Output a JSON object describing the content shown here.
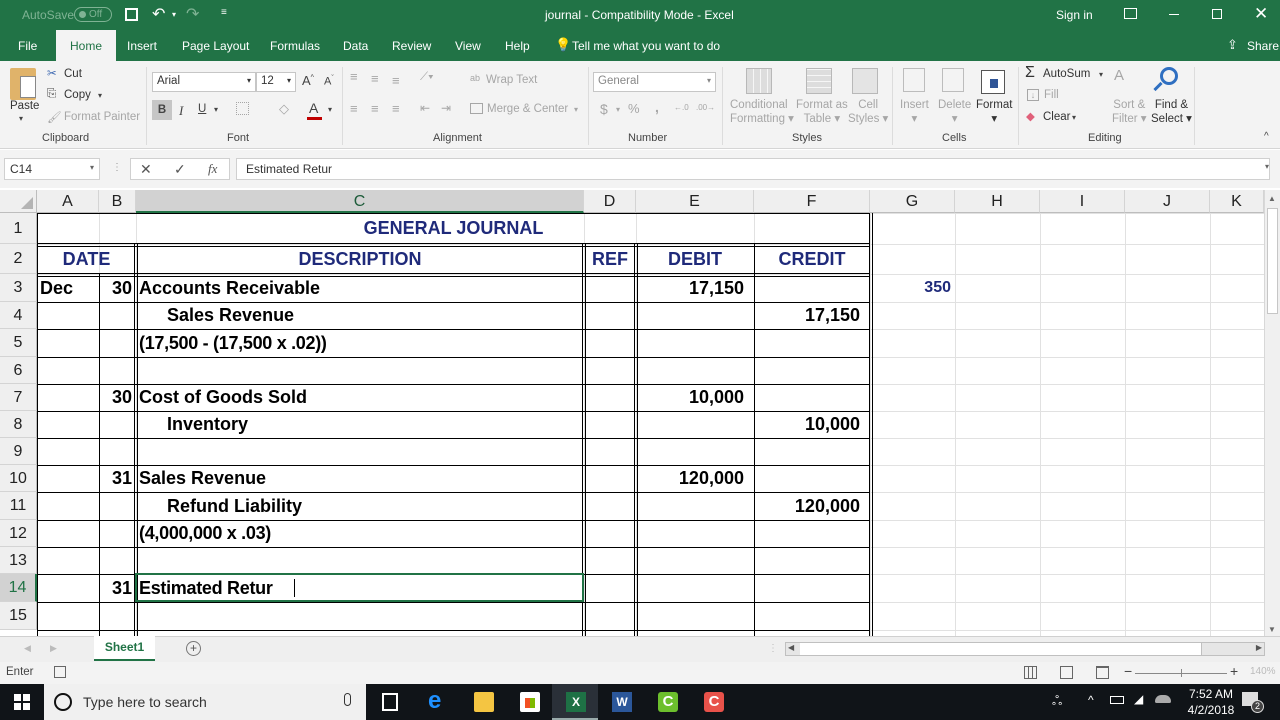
{
  "titlebar": {
    "autosave_label": "AutoSave",
    "autosave_state": "Off",
    "title": "journal  -  Compatibility Mode  -  Excel",
    "sign_in": "Sign in"
  },
  "tabs": [
    "File",
    "Home",
    "Insert",
    "Page Layout",
    "Formulas",
    "Data",
    "Review",
    "View",
    "Help"
  ],
  "tell_me": "Tell me what you want to do",
  "share": "Share",
  "ribbon": {
    "clipboard": {
      "label": "Clipboard",
      "paste": "Paste",
      "cut": "Cut",
      "copy": "Copy",
      "format_painter": "Format Painter"
    },
    "font": {
      "label": "Font",
      "font_name": "Arial",
      "font_size": "12",
      "bold": "B",
      "italic": "I",
      "underline": "U"
    },
    "alignment": {
      "label": "Alignment",
      "wrap_text": "Wrap Text",
      "merge_center": "Merge & Center"
    },
    "number": {
      "label": "Number",
      "format": "General",
      "currency": "$",
      "percent": "%",
      "comma": ","
    },
    "styles": {
      "label": "Styles",
      "conditional_1": "Conditional",
      "conditional_2": "Formatting",
      "format_table_1": "Format as",
      "format_table_2": "Table",
      "cell_styles_1": "Cell",
      "cell_styles_2": "Styles"
    },
    "cells": {
      "label": "Cells",
      "insert": "Insert",
      "delete": "Delete",
      "format": "Format"
    },
    "editing": {
      "label": "Editing",
      "autosum": "AutoSum",
      "fill": "Fill",
      "clear": "Clear",
      "sort_1": "Sort &",
      "sort_2": "Filter",
      "find_1": "Find &",
      "find_2": "Select"
    }
  },
  "formula_bar": {
    "name_box": "C14",
    "fx": "fx",
    "value": "Estimated Retur"
  },
  "columns": [
    "A",
    "B",
    "C",
    "D",
    "E",
    "F",
    "G",
    "H",
    "I",
    "J",
    "K"
  ],
  "rows": [
    "1",
    "2",
    "3",
    "4",
    "5",
    "6",
    "7",
    "8",
    "9",
    "10",
    "11",
    "12",
    "13",
    "14",
    "15"
  ],
  "sheet": {
    "title": "GENERAL JOURNAL",
    "headers": {
      "date": "DATE",
      "description": "DESCRIPTION",
      "ref": "REF",
      "debit": "DEBIT",
      "credit": "CREDIT"
    },
    "entries": [
      {
        "row": 3,
        "month": "Dec",
        "day": "30",
        "desc": "Accounts Receivable",
        "indent": false,
        "debit": "17,150",
        "credit": ""
      },
      {
        "row": 4,
        "month": "",
        "day": "",
        "desc": "Sales Revenue",
        "indent": true,
        "debit": "",
        "credit": "17,150"
      },
      {
        "row": 5,
        "month": "",
        "day": "",
        "desc": "(17,500 - (17,500 x .02))",
        "indent": false,
        "debit": "",
        "credit": ""
      },
      {
        "row": 7,
        "month": "",
        "day": "30",
        "desc": "Cost of Goods Sold",
        "indent": false,
        "debit": "10,000",
        "credit": ""
      },
      {
        "row": 8,
        "month": "",
        "day": "",
        "desc": "Inventory",
        "indent": true,
        "debit": "",
        "credit": "10,000"
      },
      {
        "row": 10,
        "month": "",
        "day": "31",
        "desc": "Sales Revenue",
        "indent": false,
        "debit": "120,000",
        "credit": ""
      },
      {
        "row": 11,
        "month": "",
        "day": "",
        "desc": "Refund Liability",
        "indent": true,
        "debit": "",
        "credit": "120,000"
      },
      {
        "row": 12,
        "month": "",
        "day": "",
        "desc": "(4,000,000 x .03)",
        "indent": false,
        "debit": "",
        "credit": ""
      },
      {
        "row": 14,
        "month": "",
        "day": "31",
        "desc": "Estimated Retur",
        "indent": false,
        "debit": "",
        "credit": ""
      }
    ],
    "side_value": "350"
  },
  "sheet_tabs": [
    "Sheet1"
  ],
  "status": {
    "mode": "Enter",
    "zoom": "140%"
  },
  "taskbar": {
    "search_placeholder": "Type here to search",
    "time": "7:52 AM",
    "date": "4/2/2018",
    "notifications": "2"
  },
  "colors": {
    "excel_green": "#217346",
    "header_navy": "#1f2a7a"
  }
}
